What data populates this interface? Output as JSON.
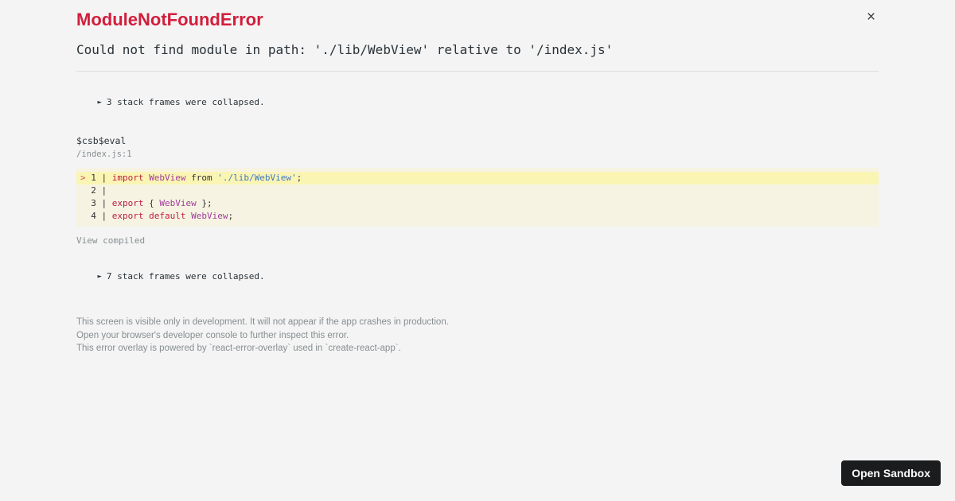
{
  "page": {
    "background": "#f4f4f4"
  },
  "header": {
    "title": "ModuleNotFoundError",
    "message": "Could not find module in path: './lib/WebView' relative to '/index.js'",
    "close_icon": "×"
  },
  "stack": {
    "arrow_icon": "►",
    "collapsed_top": "3 stack frames were collapsed.",
    "collapsed_bottom": "7 stack frames were collapsed."
  },
  "frame": {
    "function_name": "$csb$eval",
    "location": "/index.js:1",
    "view_compiled_label": "View compiled"
  },
  "code_frame": {
    "lines": [
      {
        "number": "1",
        "marker": ">",
        "highlighted": true,
        "tokens": [
          {
            "text": "import",
            "type": "keyword"
          },
          {
            "text": " ",
            "type": "plain"
          },
          {
            "text": "WebView",
            "type": "capitalized"
          },
          {
            "text": " from ",
            "type": "plain"
          },
          {
            "text": "'./lib/WebView'",
            "type": "string"
          },
          {
            "text": ";",
            "type": "plain"
          }
        ]
      },
      {
        "number": "2",
        "marker": " ",
        "highlighted": false,
        "tokens": []
      },
      {
        "number": "3",
        "marker": " ",
        "highlighted": false,
        "tokens": [
          {
            "text": "export",
            "type": "keyword"
          },
          {
            "text": " { ",
            "type": "plain"
          },
          {
            "text": "WebView",
            "type": "capitalized"
          },
          {
            "text": " }",
            "type": "plain"
          },
          {
            "text": ";",
            "type": "plain"
          }
        ]
      },
      {
        "number": "4",
        "marker": " ",
        "highlighted": false,
        "tokens": [
          {
            "text": "export",
            "type": "keyword"
          },
          {
            "text": " ",
            "type": "plain"
          },
          {
            "text": "default",
            "type": "keyword"
          },
          {
            "text": " ",
            "type": "plain"
          },
          {
            "text": "WebView",
            "type": "capitalized"
          },
          {
            "text": ";",
            "type": "plain"
          }
        ]
      }
    ]
  },
  "footer": {
    "lines": [
      "This screen is visible only in development. It will not appear if the app crashes in production.",
      "Open your browser's developer console to further inspect this error.",
      "This error overlay is powered by `react-error-overlay` used in `create-react-app`."
    ]
  },
  "actions": {
    "open_sandbox_label": "Open Sandbox"
  },
  "colors": {
    "page_bg": "#f4f4f4",
    "title": "#d21e3c",
    "text": "#293238",
    "muted": "#878e91",
    "divider": "#dcdcdc",
    "code_bg": "#f6f3e2",
    "code_highlight": "#fbf5b4",
    "code_marker": "#d65252",
    "code_keyword": "#bd1c44",
    "code_capitalized": "#a03c9b",
    "code_string": "#3c78c3",
    "code_plain": "#333333",
    "button_bg": "#1b1c1d",
    "button_text": "#ffffff"
  }
}
